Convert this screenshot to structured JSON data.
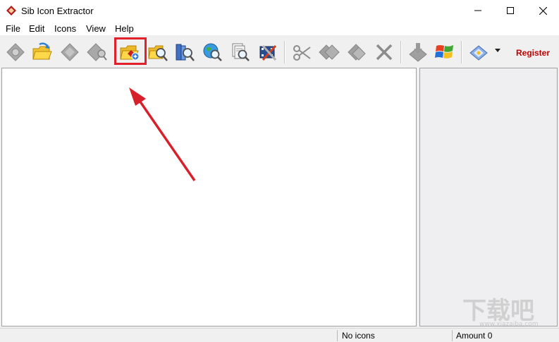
{
  "window": {
    "title": "Sib Icon Extractor",
    "icon": "sib-logo-icon"
  },
  "controls": {
    "minimize": "minimize-icon",
    "maximize": "maximize-icon",
    "close": "close-icon"
  },
  "menu": [
    {
      "label": "File"
    },
    {
      "label": "Edit"
    },
    {
      "label": "Icons"
    },
    {
      "label": "View"
    },
    {
      "label": "Help"
    }
  ],
  "toolbar": {
    "buttons": [
      {
        "icon": "disabled-gear-icon",
        "enabled": false
      },
      {
        "icon": "open-folder-icon",
        "enabled": true
      },
      {
        "icon": "disabled-diamond-icon",
        "enabled": false
      },
      {
        "icon": "disabled-search-diamond-icon",
        "enabled": false
      },
      {
        "icon": "add-folder-icon",
        "enabled": true,
        "highlighted": true
      },
      {
        "icon": "search-folder-icon",
        "enabled": true
      },
      {
        "icon": "search-library-icon",
        "enabled": true
      },
      {
        "icon": "search-globe-icon",
        "enabled": true
      },
      {
        "icon": "search-files-icon",
        "enabled": true
      },
      {
        "icon": "film-tools-icon",
        "enabled": true
      },
      {
        "icon": "cut-icon",
        "enabled": false
      },
      {
        "icon": "copy-icon",
        "enabled": false
      },
      {
        "icon": "paste-icon",
        "enabled": false
      },
      {
        "icon": "delete-icon",
        "enabled": false
      },
      {
        "icon": "save-icon",
        "enabled": false
      },
      {
        "icon": "windows-logo-icon",
        "enabled": true
      },
      {
        "icon": "settings-dropdown-icon",
        "enabled": true
      }
    ],
    "register_label": "Register"
  },
  "status": {
    "icons_text": "No icons",
    "amount_text": "Amount 0"
  },
  "watermark": {
    "text": "下载吧",
    "url": "www.xiazaiba.com"
  },
  "colors": {
    "highlight": "#e0202a",
    "register": "#c00000"
  }
}
